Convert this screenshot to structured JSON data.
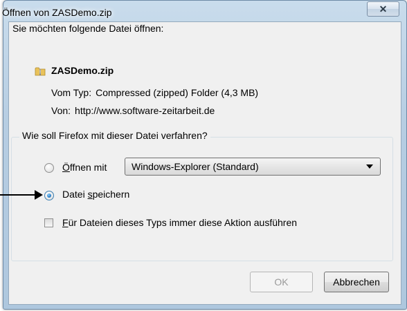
{
  "window": {
    "title": "Öffnen von ZASDemo.zip",
    "close_label": "✕"
  },
  "dialog": {
    "prompt": "Sie möchten folgende Datei öffnen:",
    "file_icon": "zip-folder-icon",
    "file_name": "ZASDemo.zip",
    "type_label": "Vom Typ:",
    "type_value": "Compressed (zipped) Folder (4,3 MB)",
    "from_label": "Von:",
    "from_value": "http://www.software-zeitarbeit.de"
  },
  "action_group": {
    "legend": "Wie soll Firefox mit dieser Datei verfahren?",
    "open_with": {
      "accesskey": "Ö",
      "rest": "ffnen mit",
      "selected": false
    },
    "open_with_app": "Windows-Explorer (Standard)",
    "save_file": {
      "before": "Datei ",
      "accesskey": "s",
      "rest": "peichern",
      "selected": true
    },
    "always": {
      "accesskey": "F",
      "rest": "ür Dateien dieses Typs immer diese Aktion ausführen",
      "checked": false
    }
  },
  "buttons": {
    "ok": "OK",
    "cancel": "Abbrechen"
  },
  "annotation": {
    "arrow": "arrow-right-pointer"
  },
  "colors": {
    "title_bar": "#b6cde2",
    "client_bg": "#f0f0f0",
    "radio_selected": "#2a7fc7",
    "disabled_text": "#9a9a9a"
  }
}
